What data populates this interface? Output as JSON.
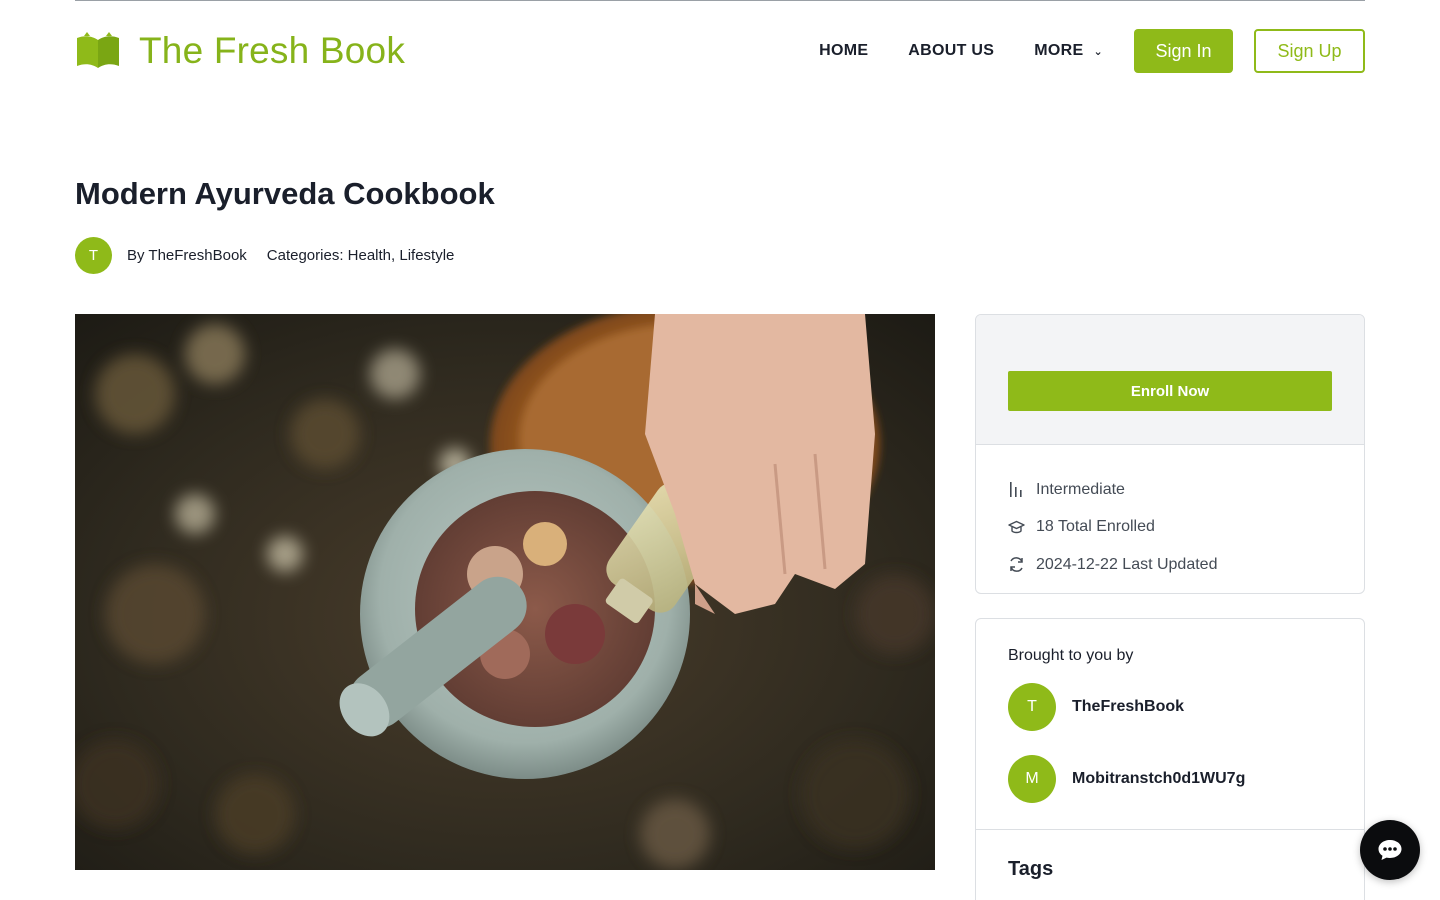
{
  "brand": {
    "name": "The Fresh Book",
    "accent": "#8fba19",
    "logo_icon": "open-book-icon"
  },
  "nav": {
    "items": [
      "HOME",
      "ABOUT US",
      "MORE"
    ],
    "more_icon": "chevron-down-icon",
    "sign_in": "Sign In",
    "sign_up": "Sign Up"
  },
  "course": {
    "title": "Modern Ayurveda Cookbook",
    "author_initial": "T",
    "by": "By TheFreshBook",
    "categories": "Categories: Health, Lifestyle",
    "image_alt_icon": "mortar-pestle-photo"
  },
  "sidebar": {
    "enroll": "Enroll Now",
    "info": [
      {
        "icon": "level-bars-icon",
        "text": "Intermediate"
      },
      {
        "icon": "graduation-cap-icon",
        "text": "18 Total Enrolled"
      },
      {
        "icon": "refresh-icon",
        "text": "2024-12-22 Last Updated"
      }
    ],
    "brought_by": "Brought to you by",
    "authors": [
      {
        "initial": "T",
        "name": "TheFreshBook"
      },
      {
        "initial": "M",
        "name": "Mobitranstch0d1WU7g"
      }
    ],
    "tags_title": "Tags"
  },
  "chat": {
    "icon": "chat-bubble-icon"
  }
}
